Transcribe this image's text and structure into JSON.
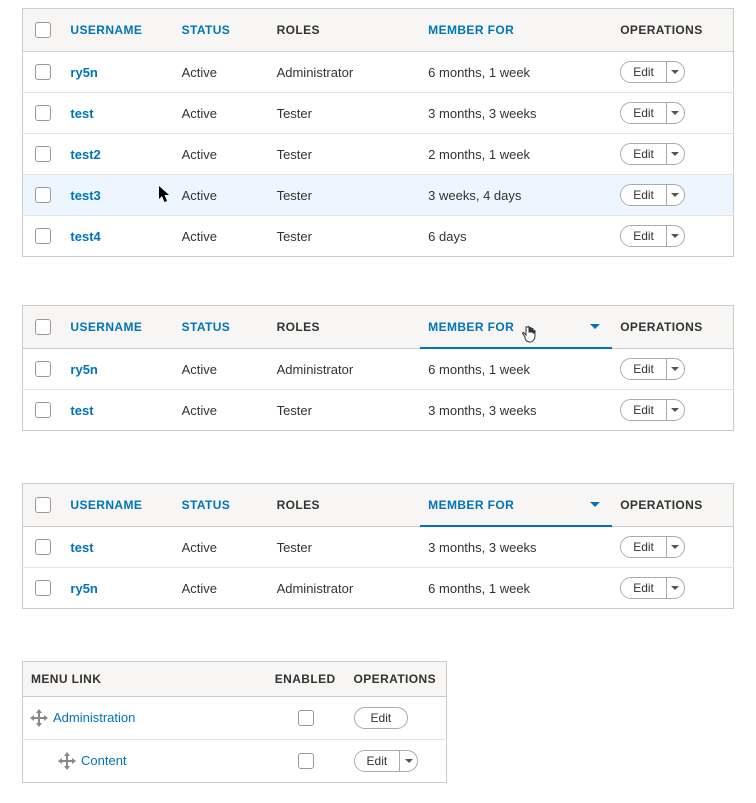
{
  "tableHeaders": {
    "username": "USERNAME",
    "status": "STATUS",
    "roles": "ROLES",
    "memberFor": "MEMBER FOR",
    "operations": "OPERATIONS"
  },
  "editLabel": "Edit",
  "menuHeaders": {
    "menuLink": "MENU LINK",
    "enabled": "ENABLED",
    "operations": "OPERATIONS"
  },
  "tables": {
    "t1": {
      "rows": [
        {
          "username": "ry5n",
          "status": "Active",
          "roles": "Administrator",
          "memberFor": "6 months, 1 week"
        },
        {
          "username": "test",
          "status": "Active",
          "roles": "Tester",
          "memberFor": "3 months, 3 weeks"
        },
        {
          "username": "test2",
          "status": "Active",
          "roles": "Tester",
          "memberFor": "2 months, 1 week"
        },
        {
          "username": "test3",
          "status": "Active",
          "roles": "Tester",
          "memberFor": "3 weeks, 4 days"
        },
        {
          "username": "test4",
          "status": "Active",
          "roles": "Tester",
          "memberFor": "6 days"
        }
      ],
      "hoverRowIndex": 3
    },
    "t2": {
      "rows": [
        {
          "username": "ry5n",
          "status": "Active",
          "roles": "Administrator",
          "memberFor": "6 months, 1 week"
        },
        {
          "username": "test",
          "status": "Active",
          "roles": "Tester",
          "memberFor": "3 months, 3 weeks"
        }
      ]
    },
    "t3": {
      "rows": [
        {
          "username": "test",
          "status": "Active",
          "roles": "Tester",
          "memberFor": "3 months, 3 weeks"
        },
        {
          "username": "ry5n",
          "status": "Active",
          "roles": "Administrator",
          "memberFor": "6 months, 1 week"
        }
      ]
    }
  },
  "menu": {
    "rows": [
      {
        "label": "Administration",
        "indent": 0,
        "split": false
      },
      {
        "label": "Content",
        "indent": 1,
        "split": true
      }
    ]
  }
}
